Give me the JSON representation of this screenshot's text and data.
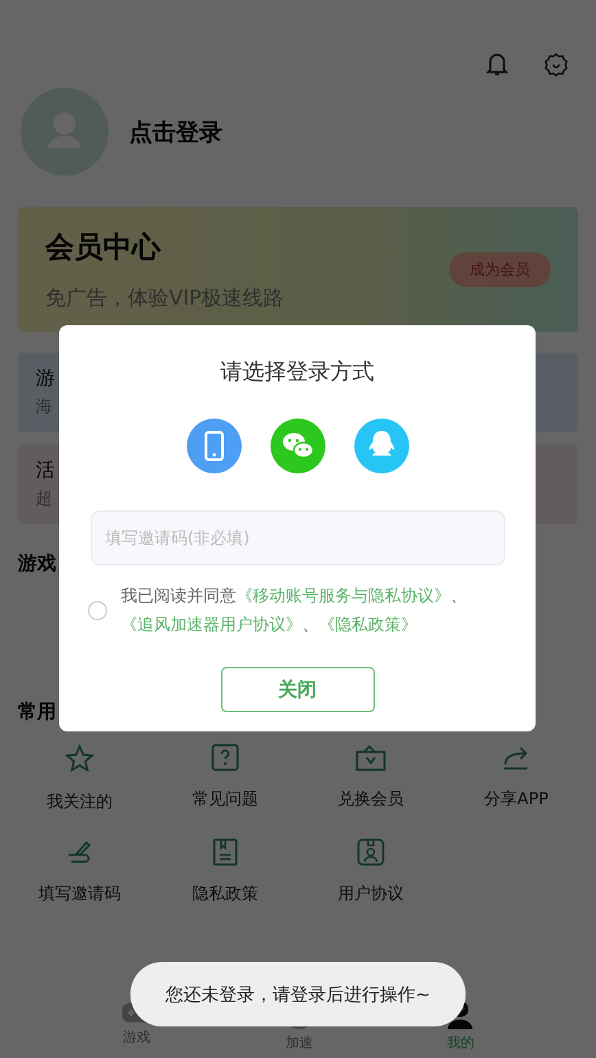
{
  "profile": {
    "login_text": "点击登录"
  },
  "vip_card": {
    "title": "会员中心",
    "subtitle": "免广告，体验VIP极速线路",
    "button": "成为会员"
  },
  "promo_cards": [
    {
      "title": "游",
      "subtitle": "海",
      "color": "#dcecf8"
    },
    {
      "title": "活",
      "subtitle": "超",
      "color": "#f7e6ea"
    }
  ],
  "game_section": {
    "title": "游戏"
  },
  "tools": {
    "title": "常用",
    "items": [
      {
        "kind": "star",
        "label": "我关注的"
      },
      {
        "kind": "question",
        "label": "常见问题"
      },
      {
        "kind": "ticket",
        "label": "兑换会员"
      },
      {
        "kind": "share",
        "label": "分享APP"
      },
      {
        "kind": "pen",
        "label": "填写邀请码"
      },
      {
        "kind": "book",
        "label": "隐私政策"
      },
      {
        "kind": "badge",
        "label": "用户协议"
      }
    ]
  },
  "tab_bar": [
    {
      "kind": "game",
      "label": "游戏",
      "selected": false
    },
    {
      "kind": "speed",
      "label": "加速",
      "selected": false
    },
    {
      "kind": "me",
      "label": "我的",
      "selected": true
    }
  ],
  "dialog": {
    "title": "请选择登录方式",
    "login_methods": [
      {
        "kind": "phone"
      },
      {
        "kind": "wechat"
      },
      {
        "kind": "qq"
      }
    ],
    "invite_field": {
      "placeholder": "填写邀请码(非必填)"
    },
    "agreement": {
      "checked": false,
      "lead": "我已阅读并同意",
      "links": [
        "《移动账号服务与隐私协议》",
        "《追风加速器用户协议》",
        "《隐私政策》"
      ],
      "separator": "、"
    },
    "close_button": "关闭"
  },
  "toast": "您还未登录，请登录后进行操作~"
}
